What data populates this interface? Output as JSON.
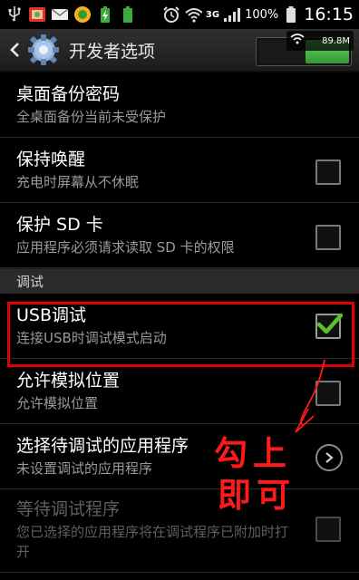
{
  "status_bar": {
    "time": "16:15",
    "battery_percent": "100%",
    "network_type": "3G",
    "icons": [
      "usb-icon",
      "gallery-icon",
      "mail-icon",
      "android-icon",
      "battery-saver-icon",
      "battery-100-icon",
      "alarm-icon",
      "wifi-icon",
      "signal-icon",
      "battery-icon"
    ]
  },
  "action_bar": {
    "title": "开发者选项",
    "master_toggle_on": true
  },
  "overlay": {
    "memory": "89.8M"
  },
  "settings": [
    {
      "id": "desktop-backup-password",
      "title": "桌面备份密码",
      "summary": "全桌面备份当前未受保护",
      "control": "none",
      "checked": false,
      "enabled": true
    },
    {
      "id": "stay-awake",
      "title": "保持唤醒",
      "summary": "充电时屏幕从不休眠",
      "control": "checkbox",
      "checked": false,
      "enabled": true
    },
    {
      "id": "protect-sd",
      "title": "保护 SD 卡",
      "summary": "应用程序必须请求读取 SD 卡的权限",
      "control": "checkbox",
      "checked": false,
      "enabled": true
    }
  ],
  "section_debug": {
    "label": "调试"
  },
  "debug_settings": [
    {
      "id": "usb-debugging",
      "title": "USB调试",
      "summary": "连接USB时调试模式启动",
      "control": "checkbox",
      "checked": true,
      "enabled": true
    },
    {
      "id": "mock-location",
      "title": "允许模拟位置",
      "summary": "允许模拟位置",
      "control": "checkbox",
      "checked": false,
      "enabled": true
    },
    {
      "id": "select-debug-app",
      "title": "选择待调试的应用程序",
      "summary": "未设置调试的应用程序",
      "control": "chevron",
      "checked": false,
      "enabled": true
    },
    {
      "id": "wait-for-debugger",
      "title": "等待调试程序",
      "summary": "您已选择的应用程序将在调试程序已附加时打开",
      "control": "checkbox",
      "checked": false,
      "enabled": false
    }
  ],
  "annotation": {
    "line1": "勾上",
    "line2": "即可",
    "color": "#ff1a1a"
  },
  "colors": {
    "accent_green": "#4caf2f",
    "highlight_red": "#e00000"
  }
}
